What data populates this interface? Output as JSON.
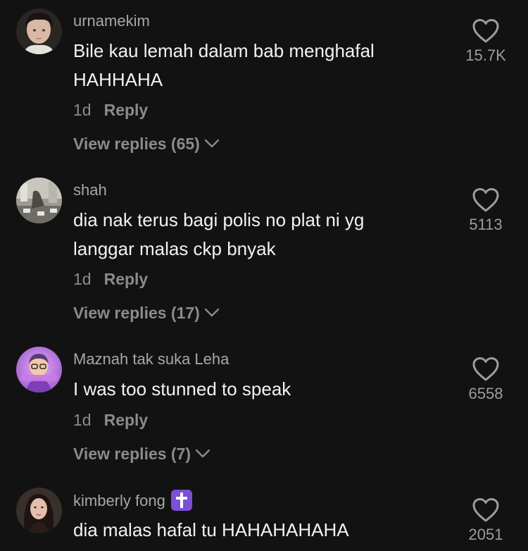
{
  "colors": {
    "background": "#121212",
    "username": "#a7a7a9",
    "text": "#f2f2f2",
    "muted": "#8b8b8d",
    "badge": "#7b4fd6"
  },
  "comments": [
    {
      "username": "urnamekim",
      "text_lines": [
        "Bile kau lemah dalam bab menghafal",
        "HAHHAHA"
      ],
      "time": "1d",
      "reply_label": "Reply",
      "view_replies": "View replies (65)",
      "likes": "15.7K"
    },
    {
      "username": "shah",
      "text_lines": [
        "dia nak terus bagi polis no plat ni yg",
        "langgar malas ckp bnyak"
      ],
      "time": "1d",
      "reply_label": "Reply",
      "view_replies": "View replies (17)",
      "likes": "5113"
    },
    {
      "username": "Maznah tak suka Leha",
      "text_lines": [
        "I was too stunned to speak"
      ],
      "time": "1d",
      "reply_label": "Reply",
      "view_replies": "View replies (7)",
      "likes": "6558"
    },
    {
      "username": "kimberly fong",
      "text_lines": [
        "dia malas hafal tu HAHAHAHAHA"
      ],
      "likes": "2051",
      "badge_icon": "latin-cross-icon"
    }
  ]
}
